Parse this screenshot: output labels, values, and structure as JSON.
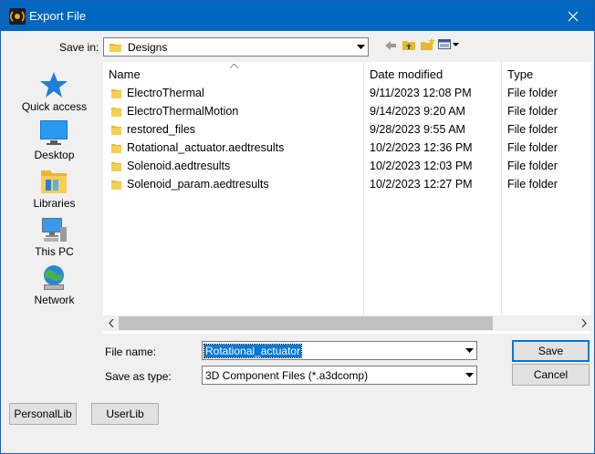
{
  "window": {
    "title": "Export File"
  },
  "save_in": {
    "label": "Save in:",
    "value": "Designs"
  },
  "places": [
    {
      "label": "Quick access",
      "icon": "star-icon"
    },
    {
      "label": "Desktop",
      "icon": "desktop-icon"
    },
    {
      "label": "Libraries",
      "icon": "libraries-icon"
    },
    {
      "label": "This PC",
      "icon": "computer-icon"
    },
    {
      "label": "Network",
      "icon": "network-icon"
    }
  ],
  "columns": {
    "name": "Name",
    "date": "Date modified",
    "type": "Type"
  },
  "files": [
    {
      "name": "ElectroThermal",
      "date": "9/11/2023 12:08 PM",
      "type": "File folder"
    },
    {
      "name": "ElectroThermalMotion",
      "date": "9/14/2023 9:20 AM",
      "type": "File folder"
    },
    {
      "name": "restored_files",
      "date": "9/28/2023 9:55 AM",
      "type": "File folder"
    },
    {
      "name": "Rotational_actuator.aedtresults",
      "date": "10/2/2023 12:36 PM",
      "type": "File folder"
    },
    {
      "name": "Solenoid.aedtresults",
      "date": "10/2/2023 12:03 PM",
      "type": "File folder"
    },
    {
      "name": "Solenoid_param.aedtresults",
      "date": "10/2/2023 12:27 PM",
      "type": "File folder"
    }
  ],
  "file_name": {
    "label": "File name:",
    "value": "Rotational_actuator"
  },
  "save_as_type": {
    "label": "Save as type:",
    "value": "3D Component Files (*.a3dcomp)"
  },
  "buttons": {
    "save": "Save",
    "cancel": "Cancel",
    "personal_lib": "PersonalLib",
    "user_lib": "UserLib"
  },
  "colors": {
    "titlebar": "#0067c0",
    "selection": "#0078d7",
    "folder": "#e8b730"
  }
}
